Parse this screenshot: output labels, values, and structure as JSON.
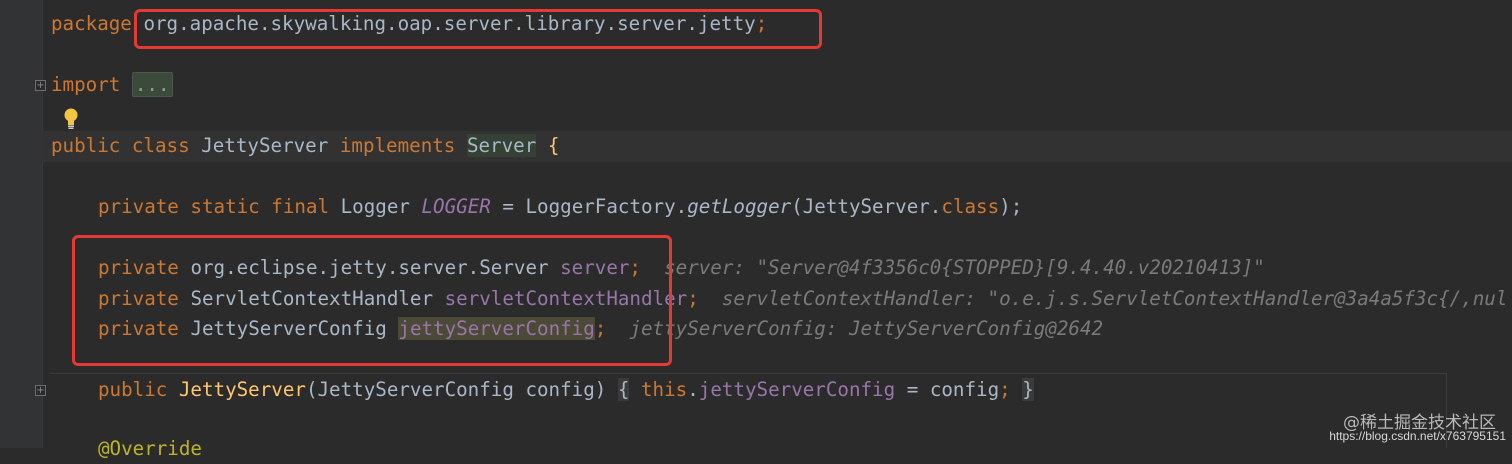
{
  "editor": {
    "package_line": {
      "keyword": "package",
      "name": "org.apache.skywalking.oap.server.library.server.jetty",
      "semicolon": ";"
    },
    "import_line": {
      "keyword": "import",
      "folded": "..."
    },
    "class_line": {
      "kw_public": "public",
      "kw_class": "class",
      "class_name": "JettyServer",
      "kw_implements": "implements",
      "interface_name": "Server",
      "brace": "{"
    },
    "logger_line": {
      "modifiers": "private static final",
      "type": "Logger",
      "name": "LOGGER",
      "eq": "=",
      "factory": "LoggerFactory.",
      "method": "getLogger",
      "arg_open": "(JettyServer.",
      "kw_class": "class",
      "arg_close": ");"
    },
    "field_server": {
      "modifier": "private",
      "type": "org.eclipse.jetty.server.Server",
      "name": "server",
      "semicolon": ";",
      "hint": "server: \"Server@4f3356c0{STOPPED}[9.4.40.v20210413]\""
    },
    "field_handler": {
      "modifier": "private",
      "type": "ServletContextHandler",
      "name": "servletContextHandler",
      "semicolon": ";",
      "hint": "servletContextHandler: \"o.e.j.s.ServletContextHandler@3a4a5f3c{/,nul"
    },
    "field_config": {
      "modifier": "private",
      "type": "JettyServerConfig",
      "name": "jettyServerConfig",
      "semicolon": ";",
      "hint": "jettyServerConfig: JettyServerConfig@2642"
    },
    "constructor_line": {
      "kw_public": "public",
      "name": "JettyServer",
      "params": "(JettyServerConfig config)",
      "open_brace": "{",
      "kw_this": "this",
      "dot": ".",
      "field": "jettyServerConfig",
      "assign": " = config",
      "semicolon": ";",
      "close_brace": "}"
    },
    "annotation_line": {
      "text": "@Override"
    }
  },
  "watermark": {
    "text": "@稀土掘金技术社区",
    "url": "https://blog.csdn.net/x763795151"
  },
  "colors": {
    "background": "#2b2b2b",
    "keyword": "#cc7832",
    "field": "#9876aa",
    "method": "#ffc66d",
    "highlight_box": "#e53935"
  }
}
